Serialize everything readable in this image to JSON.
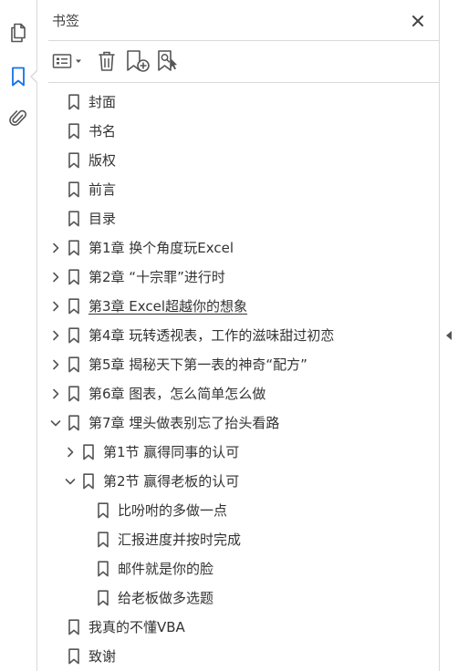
{
  "rail": {
    "items": [
      {
        "name": "pages-icon",
        "active": false
      },
      {
        "name": "bookmark-icon",
        "active": true
      },
      {
        "name": "attachment-icon",
        "active": false
      }
    ]
  },
  "panel": {
    "title": "书签",
    "toolbar": {
      "options": "options-list-icon",
      "delete": "trash-icon",
      "new_bookmark": "new-bookmark-icon",
      "find_bookmark": "find-bookmark-icon"
    }
  },
  "bookmarks": [
    {
      "label": "封面",
      "level": 0,
      "toggle": "none"
    },
    {
      "label": "书名",
      "level": 0,
      "toggle": "none"
    },
    {
      "label": "版权",
      "level": 0,
      "toggle": "none"
    },
    {
      "label": "前言",
      "level": 0,
      "toggle": "none"
    },
    {
      "label": "目录",
      "level": 0,
      "toggle": "none"
    },
    {
      "label": "第1章 换个角度玩Excel",
      "level": 0,
      "toggle": "collapsed"
    },
    {
      "label": "第2章 “十宗罪”进行时",
      "level": 0,
      "toggle": "collapsed"
    },
    {
      "label": "第3章 Excel超越你的想象",
      "level": 0,
      "toggle": "collapsed",
      "underlined": true
    },
    {
      "label": "第4章 玩转透视表，工作的滋味甜过初恋",
      "level": 0,
      "toggle": "collapsed"
    },
    {
      "label": "第5章 揭秘天下第一表的神奇“配方”",
      "level": 0,
      "toggle": "collapsed"
    },
    {
      "label": "第6章 图表，怎么简单怎么做",
      "level": 0,
      "toggle": "collapsed"
    },
    {
      "label": "第7章 埋头做表别忘了抬头看路",
      "level": 0,
      "toggle": "expanded"
    },
    {
      "label": "第1节 赢得同事的认可",
      "level": 1,
      "toggle": "collapsed"
    },
    {
      "label": "第2节 赢得老板的认可",
      "level": 1,
      "toggle": "expanded"
    },
    {
      "label": "比吩咐的多做一点",
      "level": 2,
      "toggle": "none"
    },
    {
      "label": "汇报进度并按时完成",
      "level": 2,
      "toggle": "none"
    },
    {
      "label": "邮件就是你的脸",
      "level": 2,
      "toggle": "none"
    },
    {
      "label": "给老板做多选题",
      "level": 2,
      "toggle": "none"
    },
    {
      "label": "我真的不懂VBA",
      "level": 0,
      "toggle": "none"
    },
    {
      "label": "致谢",
      "level": 0,
      "toggle": "none"
    }
  ],
  "colors": {
    "accent": "#1473e6",
    "icon": "#555555",
    "divider": "#d9d9d9"
  }
}
